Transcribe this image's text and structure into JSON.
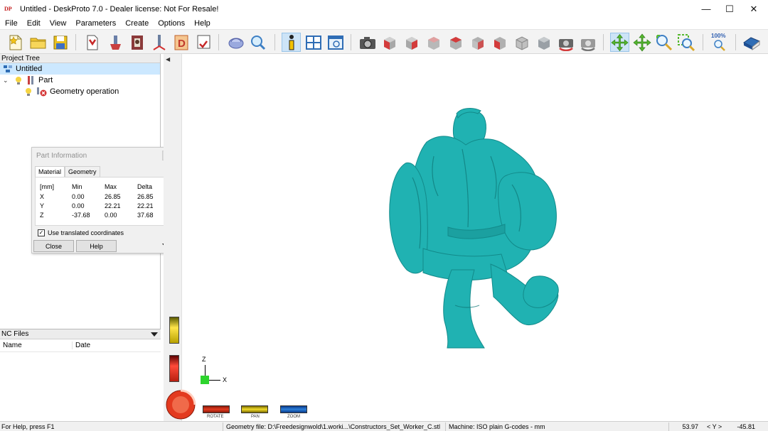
{
  "window": {
    "title": "Untitled - DeskProto 7.0 - Dealer license: Not For Resale!",
    "icon_label": "DP",
    "controls": {
      "minimize": "—",
      "maximize": "☐",
      "close": "✕"
    }
  },
  "menu": {
    "items": [
      "File",
      "Edit",
      "View",
      "Parameters",
      "Create",
      "Options",
      "Help"
    ]
  },
  "toolbar": {
    "zoom_label": "100%",
    "colors": {
      "accent_active": "#cde4f7",
      "cube_red": "#d33b3b",
      "cube_gray": "#9aa0a6",
      "move_green": "#56b82e"
    }
  },
  "project_tree": {
    "header": "Project Tree",
    "items": [
      {
        "label": "Untitled",
        "icon": "project-icon"
      },
      {
        "label": "Part",
        "icon": "part-icon"
      },
      {
        "label": "Geometry operation",
        "icon": "geometry-operation-icon"
      }
    ]
  },
  "part_info": {
    "title": "Part Information",
    "tabs": [
      "Material",
      "Geometry"
    ],
    "active_tab": "Material",
    "columns": [
      "[mm]",
      "Min",
      "Max",
      "Delta"
    ],
    "rows": [
      {
        "axis": "X",
        "min": "0.00",
        "max": "26.85",
        "delta": "26.85"
      },
      {
        "axis": "Y",
        "min": "0.00",
        "max": "22.21",
        "delta": "22.21"
      },
      {
        "axis": "Z",
        "min": "-37.68",
        "max": "0.00",
        "delta": "37.68"
      }
    ],
    "checkbox_label": "Use translated coordinates",
    "checkbox_checked": true,
    "close_label": "Close",
    "help_label": "Help"
  },
  "nc_files": {
    "header": "NC Files",
    "columns": [
      "Name",
      "Date"
    ]
  },
  "viewport": {
    "model_color": "#20b2b2",
    "axis_z": "Z",
    "axis_x": "X",
    "mouse_modes": [
      {
        "label": "ROTATE",
        "color": "#d9342b"
      },
      {
        "label": "PAN",
        "color": "#e8d42a"
      },
      {
        "label": "ZOOM",
        "color": "#2b7fd9"
      }
    ]
  },
  "status": {
    "help": "For Help, press F1",
    "geometry_file": "Geometry file: D:\\Freedesignwold\\1.worki...\\Constructors_Set_Worker_C.stl",
    "machine": "Machine: ISO plain G-codes - mm",
    "x_value": "53.97",
    "y_label": "< Y >",
    "y_value": "-45.81"
  }
}
